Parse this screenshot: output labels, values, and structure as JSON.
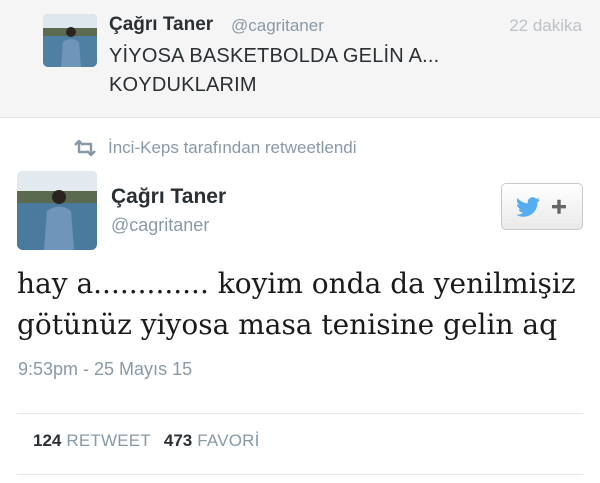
{
  "reply_tweet": {
    "name": "Çağrı Taner",
    "handle": "@cagritaner",
    "time": "22 dakika",
    "text_line1": "YİYOSA BASKETBOLDA GELİN A...",
    "text_line2": "KOYDUKLARIM"
  },
  "retweet_context": {
    "icon": "retweet-icon",
    "text": "İnci-Keps tarafından retweetlendi"
  },
  "main_tweet": {
    "name": "Çağrı Taner",
    "handle": "@cagritaner",
    "follow_icon": "twitter-bird-plus-icon",
    "text_line1": "hay a............. koyim onda da yenilmişiz",
    "text_line2": "götünüz yiyosa masa tenisine gelin aq",
    "timestamp": "9:53pm - 25 Mayıs 15"
  },
  "stats": {
    "retweets_count": "124",
    "retweets_label": "RETWEET",
    "favorites_count": "473",
    "favorites_label": "FAVORİ"
  },
  "colors": {
    "twitter_blue": "#55acee",
    "muted_text": "#8899a6",
    "reply_background": "#f5f5f5"
  }
}
